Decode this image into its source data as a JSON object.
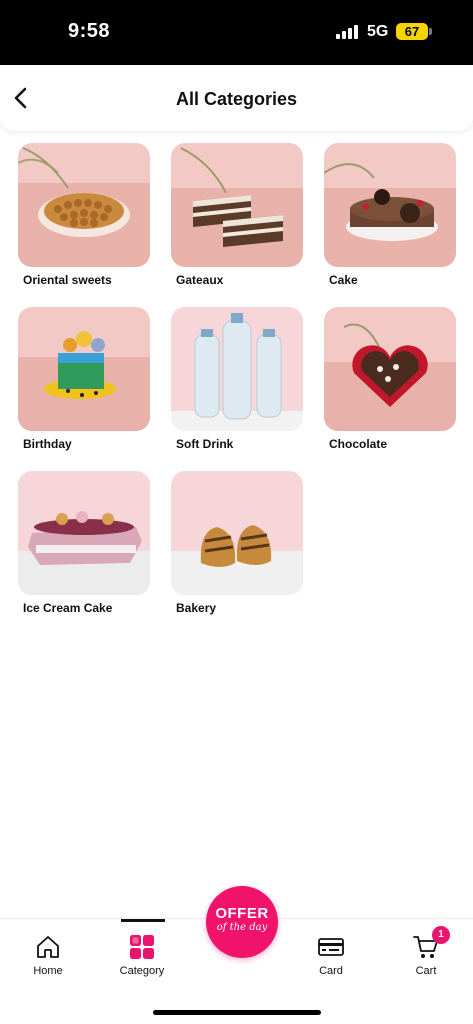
{
  "status_bar": {
    "time": "9:58",
    "network": "5G",
    "battery": "67"
  },
  "header": {
    "title": "All Categories",
    "back_icon": "chevron-left-icon"
  },
  "categories": [
    {
      "label": "Oriental sweets"
    },
    {
      "label": "Gateaux"
    },
    {
      "label": "Cake"
    },
    {
      "label": "Birthday"
    },
    {
      "label": "Soft Drink"
    },
    {
      "label": "Chocolate"
    },
    {
      "label": "Ice Cream Cake"
    },
    {
      "label": "Bakery"
    }
  ],
  "bottom_nav": {
    "items": [
      {
        "label": "Home",
        "icon": "home-icon"
      },
      {
        "label": "Category",
        "icon": "grid-icon",
        "active": true
      },
      {
        "label": "Card",
        "icon": "credit-card-icon"
      },
      {
        "label": "Cart",
        "icon": "cart-icon",
        "badge": "1"
      }
    ],
    "offer": {
      "main": "OFFER",
      "sub": "of the day"
    }
  },
  "colors": {
    "accent": "#f0126b",
    "badge": "#e8146e",
    "thumb_bg": "#f2c6c3"
  }
}
